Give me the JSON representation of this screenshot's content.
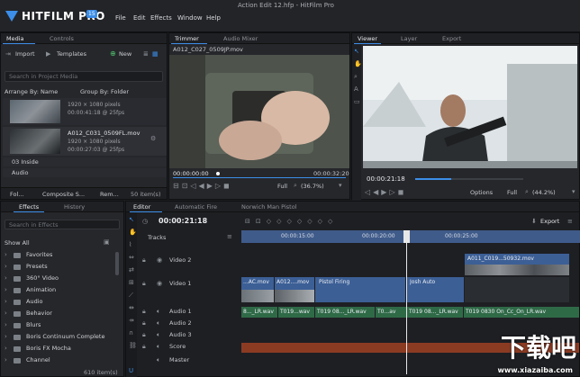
{
  "app": {
    "brand": "HITFILM PRO",
    "badge": "15",
    "window_title": "Action Edit 12.hfp - HitFilm Pro",
    "menu": [
      "File",
      "Edit",
      "Effects",
      "Window",
      "Help"
    ]
  },
  "media_panel": {
    "tabs": [
      "Media",
      "Controls"
    ],
    "import_label": "Import",
    "templates_label": "Templates",
    "new_label": "New",
    "search_placeholder": "Search in Project Media",
    "arrange_label": "Arrange By: Name",
    "group_label": "Group By: Folder",
    "items": [
      {
        "name": "",
        "line1": "1920 × 1080 pixels",
        "line2": "00:00:41:18 @ 25fps"
      },
      {
        "name": "A012_C031_0509FL.mov",
        "line1": "1920 × 1080 pixels",
        "line2": "00:00:27:03 @ 25fps"
      }
    ],
    "folders": [
      "03 Inside",
      "Audio"
    ],
    "footer": {
      "folder": "Fol...",
      "composite": "Composite S...",
      "remove": "Rem...",
      "count": "50 item(s)"
    }
  },
  "trimmer": {
    "tabs": [
      "Trimmer",
      "Audio Mixer"
    ],
    "clip_name": "A012_C027_0509JP.mov",
    "timecode": "00:00:00:00",
    "end_time": "00:00:32:20",
    "zoom_mode": "Full",
    "zoom_pct": "(36.7%)"
  },
  "viewer": {
    "tabs": [
      "Viewer",
      "Layer",
      "Export"
    ],
    "timecode": "00:00:21:18",
    "options_label": "Options",
    "quality": "Full",
    "zoom_pct": "(44.2%)"
  },
  "effects_panel": {
    "tabs": [
      "Effects",
      "History"
    ],
    "search_placeholder": "Search in Effects",
    "show_label": "Show All",
    "items": [
      "Favorites",
      "Presets",
      "360° Video",
      "Animation",
      "Audio",
      "Behavior",
      "Blurs",
      "Boris Continuum Complete",
      "Boris FX Mocha",
      "Channel"
    ],
    "count": "610 item(s)"
  },
  "editor": {
    "tabs": [
      "Editor",
      "Automatic Fire",
      "Norwich Man Pistol"
    ],
    "timecode": "00:00:21:18",
    "tracks_label": "Tracks",
    "export_label": "Export",
    "ruler_marks": [
      "00:00:15:00",
      "00:00:20:00",
      "00:00:25:00"
    ],
    "video_tracks": [
      "Video 2",
      "Video 1"
    ],
    "audio_tracks": [
      "Audio 1",
      "Audio 2",
      "Audio 3",
      "Score",
      "Master"
    ],
    "video2_clip": "A011_C019...50932.mov",
    "video1_clips": [
      "...AC.mov",
      "A012....mov",
      "Pistol Firing",
      "Josh Auto"
    ],
    "audio1_clips": [
      "8..._LR.wav",
      "T019...wav",
      "T019 08..._LR.wav",
      "T0...av",
      "T019 08..._LR.wav",
      "T019 0830 On_Cc_On_LR.wav"
    ]
  },
  "watermark": {
    "text": "下载吧",
    "url": "www.xiazaiba.com"
  }
}
